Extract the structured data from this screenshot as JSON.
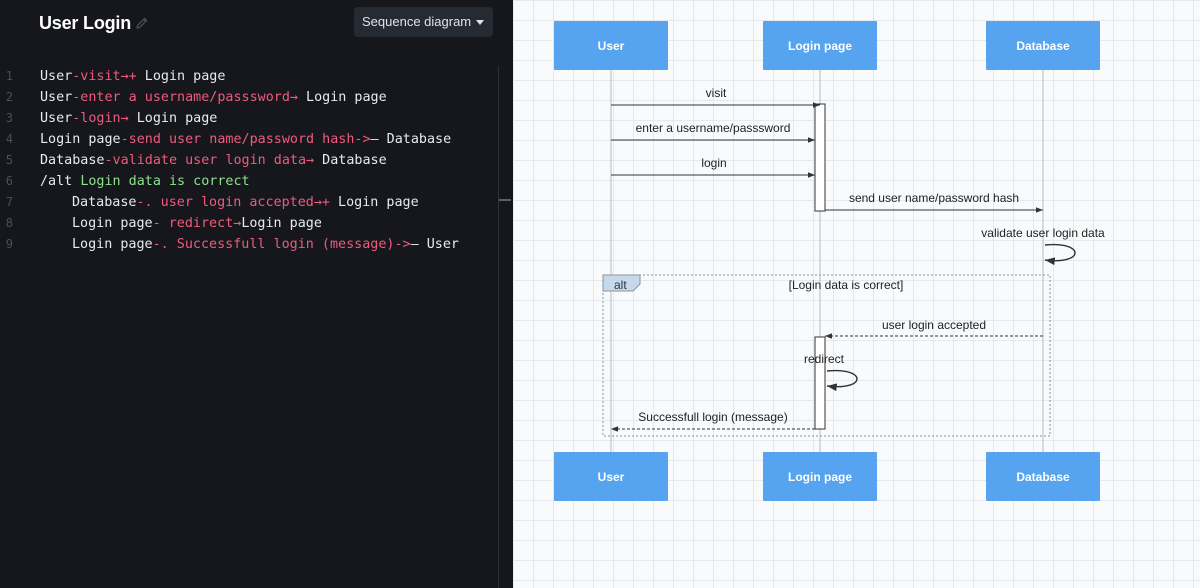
{
  "app": {
    "title": "User Login",
    "diagram_type": "Sequence diagram"
  },
  "editor": {
    "lines": [
      {
        "num": "1",
        "segments": [
          {
            "t": "User",
            "c": "w"
          },
          {
            "t": "-visit→+",
            "c": "k"
          },
          {
            "t": " Login page",
            "c": "w"
          }
        ]
      },
      {
        "num": "2",
        "segments": [
          {
            "t": "User",
            "c": "w"
          },
          {
            "t": "-enter a username/passsword→",
            "c": "k"
          },
          {
            "t": " Login page",
            "c": "w"
          }
        ]
      },
      {
        "num": "3",
        "segments": [
          {
            "t": "User",
            "c": "w"
          },
          {
            "t": "-login→",
            "c": "k"
          },
          {
            "t": " Login page",
            "c": "w"
          }
        ]
      },
      {
        "num": "4",
        "segments": [
          {
            "t": "Login page",
            "c": "w"
          },
          {
            "t": "-send user name/password hash->",
            "c": "k"
          },
          {
            "t": "— Database",
            "c": "w"
          }
        ]
      },
      {
        "num": "5",
        "segments": [
          {
            "t": "Database",
            "c": "w"
          },
          {
            "t": "-validate user login data→",
            "c": "k"
          },
          {
            "t": " Database",
            "c": "w"
          }
        ]
      },
      {
        "num": "6",
        "segments": [
          {
            "t": "/alt ",
            "c": "w"
          },
          {
            "t": "Login data is correct",
            "c": "g"
          }
        ]
      },
      {
        "num": "7",
        "indent": true,
        "segments": [
          {
            "t": "Database",
            "c": "w"
          },
          {
            "t": "-. user login accepted→+",
            "c": "k"
          },
          {
            "t": " Login page",
            "c": "w"
          }
        ]
      },
      {
        "num": "8",
        "indent": true,
        "segments": [
          {
            "t": "Login page",
            "c": "w"
          },
          {
            "t": "- redirect→",
            "c": "k"
          },
          {
            "t": "Login page",
            "c": "w"
          }
        ]
      },
      {
        "num": "9",
        "indent": true,
        "segments": [
          {
            "t": "Login page",
            "c": "w"
          },
          {
            "t": "-. Successfull login (message)->",
            "c": "k"
          },
          {
            "t": "— User",
            "c": "w"
          }
        ]
      }
    ]
  },
  "diagram": {
    "participants": [
      "User",
      "Login page",
      "Database"
    ],
    "messages": [
      {
        "from": 0,
        "to": 1,
        "label": "visit",
        "dashed": false
      },
      {
        "from": 0,
        "to": 1,
        "label": "enter a username/passsword",
        "dashed": false
      },
      {
        "from": 0,
        "to": 1,
        "label": "login",
        "dashed": false
      },
      {
        "from": 1,
        "to": 2,
        "label": "send user name/password hash",
        "dashed": false
      },
      {
        "from": 2,
        "to": 2,
        "label": "validate user login data",
        "dashed": false
      },
      {
        "from": 2,
        "to": 1,
        "label": "user login accepted",
        "dashed": true
      },
      {
        "from": 1,
        "to": 1,
        "label": "redirect",
        "dashed": false
      },
      {
        "from": 1,
        "to": 0,
        "label": "Successfull login (message)",
        "dashed": true
      }
    ],
    "alt_block": {
      "keyword": "alt",
      "condition": "[Login data is correct]"
    }
  },
  "colors": {
    "editor_bg": "#15171c",
    "keyword": "#f05a7e",
    "condition": "#8be28b",
    "participant_fill": "#56a3ef",
    "alt_tab": "#c4d9ec"
  }
}
